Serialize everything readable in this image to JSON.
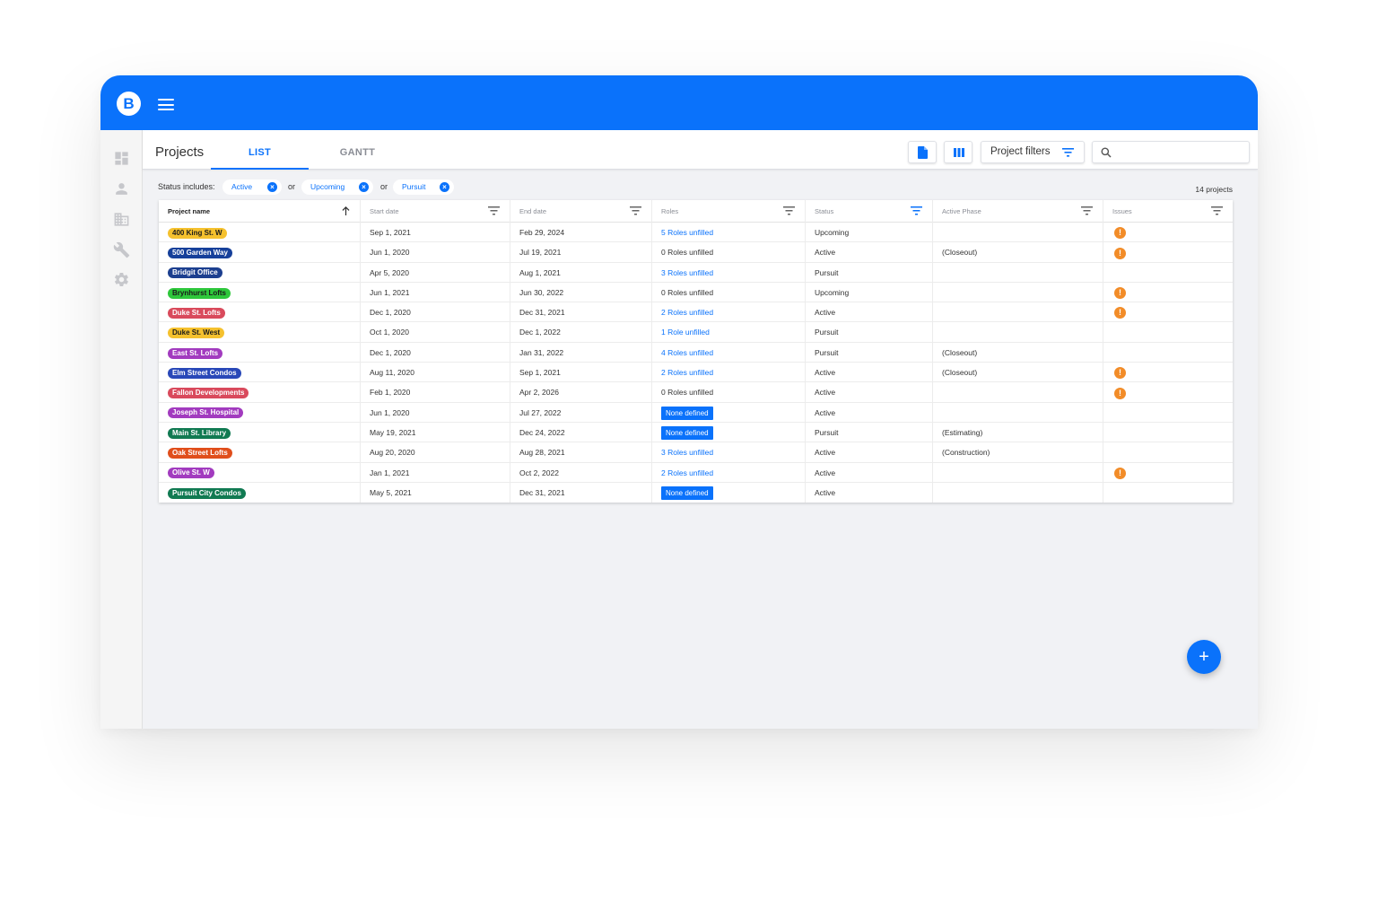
{
  "app": {
    "logo_letter": "B"
  },
  "header": {
    "page_title": "Projects",
    "tabs": [
      {
        "label": "LIST",
        "active": true
      },
      {
        "label": "GANTT",
        "active": false
      }
    ],
    "filters_label": "Project filters",
    "search_placeholder": ""
  },
  "sidebar": {
    "items": [
      "dashboard-icon",
      "person-icon",
      "building-icon",
      "wrench-icon",
      "settings-icon"
    ]
  },
  "status_filter": {
    "label": "Status includes:",
    "chips": [
      "Active",
      "Upcoming",
      "Pursuit"
    ],
    "joiner": "or",
    "count_text": "14 projects"
  },
  "table": {
    "columns": [
      "Project name",
      "Start date",
      "End date",
      "Roles",
      "Status",
      "Active Phase",
      "Issues"
    ],
    "rows": [
      {
        "name": "400 King St. W",
        "color": "#f5c12e",
        "start": "Sep 1, 2021",
        "end": "Feb 29, 2024",
        "roles": "5 Roles unfilled",
        "roles_type": "link",
        "status": "Upcoming",
        "phase": "",
        "issue": true
      },
      {
        "name": "500 Garden Way",
        "color": "#16409a",
        "start": "Jun 1, 2020",
        "end": "Jul 19, 2021",
        "roles": "0 Roles unfilled",
        "roles_type": "plain",
        "status": "Active",
        "phase": "(Closeout)",
        "issue": true
      },
      {
        "name": "Bridgit Office",
        "color": "#1c3f8f",
        "start": "Apr 5, 2020",
        "end": "Aug 1, 2021",
        "roles": "3 Roles unfilled",
        "roles_type": "link",
        "status": "Pursuit",
        "phase": "",
        "issue": false
      },
      {
        "name": "Brynhurst Lofts",
        "color": "#2ec73b",
        "start": "Jun 1, 2021",
        "end": "Jun 30, 2022",
        "roles": "0 Roles unfilled",
        "roles_type": "plain",
        "status": "Upcoming",
        "phase": "",
        "issue": true
      },
      {
        "name": "Duke St. Lofts",
        "color": "#d94a5c",
        "start": "Dec 1, 2020",
        "end": "Dec 31, 2021",
        "roles": "2 Roles unfilled",
        "roles_type": "link",
        "status": "Active",
        "phase": "",
        "issue": true
      },
      {
        "name": "Duke St. West",
        "color": "#f5c12e",
        "start": "Oct 1, 2020",
        "end": "Dec 1, 2022",
        "roles": "1 Role unfilled",
        "roles_type": "link",
        "status": "Pursuit",
        "phase": "",
        "issue": false
      },
      {
        "name": "East St. Lofts",
        "color": "#a23bbf",
        "start": "Dec 1, 2020",
        "end": "Jan 31, 2022",
        "roles": "4 Roles unfilled",
        "roles_type": "link",
        "status": "Pursuit",
        "phase": "(Closeout)",
        "issue": false
      },
      {
        "name": "Elm Street Condos",
        "color": "#2948b8",
        "start": "Aug 11, 2020",
        "end": "Sep 1, 2021",
        "roles": "2 Roles unfilled",
        "roles_type": "link",
        "status": "Active",
        "phase": "(Closeout)",
        "issue": true
      },
      {
        "name": "Fallon Developments",
        "color": "#d94a5c",
        "start": "Feb 1, 2020",
        "end": "Apr 2, 2026",
        "roles": "0 Roles unfilled",
        "roles_type": "plain",
        "status": "Active",
        "phase": "",
        "issue": true
      },
      {
        "name": "Joseph St. Hospital",
        "color": "#a23bbf",
        "start": "Jun 1, 2020",
        "end": "Jul 27, 2022",
        "roles": "None defined",
        "roles_type": "none",
        "status": "Active",
        "phase": "",
        "issue": false
      },
      {
        "name": "Main St. Library",
        "color": "#117a52",
        "start": "May 19, 2021",
        "end": "Dec 24, 2022",
        "roles": "None defined",
        "roles_type": "none",
        "status": "Pursuit",
        "phase": "(Estimating)",
        "issue": false
      },
      {
        "name": "Oak Street Lofts",
        "color": "#e04e1b",
        "start": "Aug 20, 2020",
        "end": "Aug 28, 2021",
        "roles": "3 Roles unfilled",
        "roles_type": "link",
        "status": "Active",
        "phase": "(Construction)",
        "issue": false
      },
      {
        "name": "Olive St. W",
        "color": "#a23bbf",
        "start": "Jan 1, 2021",
        "end": "Oct 2, 2022",
        "roles": "2 Roles unfilled",
        "roles_type": "link",
        "status": "Active",
        "phase": "",
        "issue": true
      },
      {
        "name": "Pursuit City Condos",
        "color": "#117a52",
        "start": "May 5, 2021",
        "end": "Dec 31, 2021",
        "roles": "None defined",
        "roles_type": "none",
        "status": "Active",
        "phase": "",
        "issue": false
      }
    ]
  },
  "fab": {
    "label": "+"
  },
  "colors": {
    "accent": "#0a72fb",
    "issue": "#f28c28",
    "background": "#f1f2f5"
  }
}
